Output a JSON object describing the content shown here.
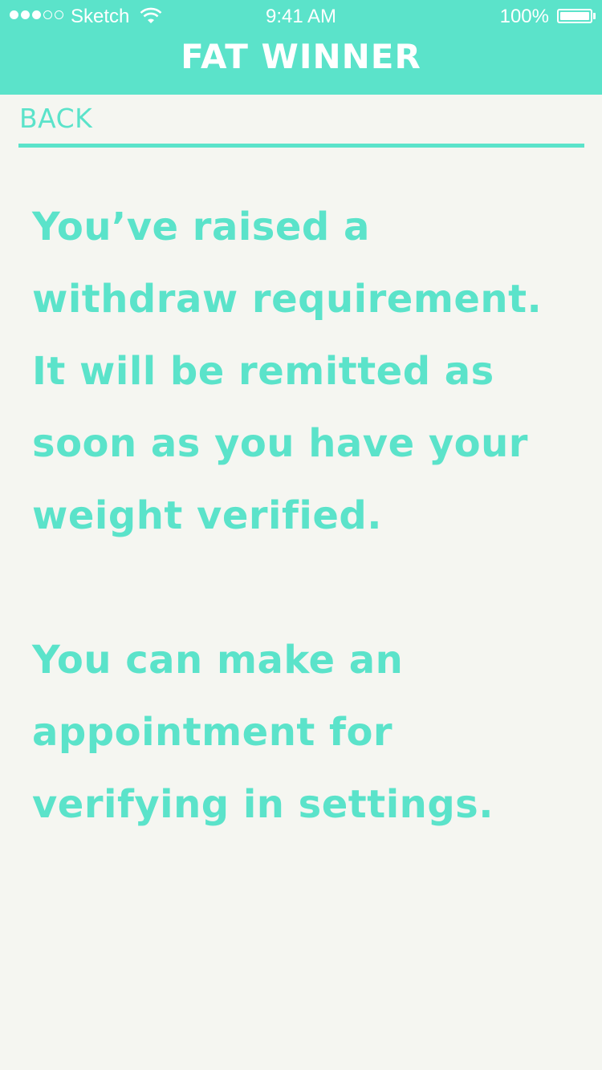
{
  "status_bar": {
    "carrier": "Sketch",
    "time": "9:41 AM",
    "battery": "100%",
    "signal_icon": "signal-dots-icon",
    "wifi_icon": "wifi-icon",
    "battery_icon": "battery-icon"
  },
  "header": {
    "title": "FAT WINNER",
    "color": "#5be3ca"
  },
  "nav": {
    "back_label": "BACK"
  },
  "content": {
    "paragraph_1": "You’ve raised a withdraw requirement. It will be remitted as soon as you have your weight verified.",
    "paragraph_2": "You can make an appointment for verifying in settings."
  },
  "colors": {
    "accent": "#5be3ca",
    "background": "#f5f6f1"
  }
}
